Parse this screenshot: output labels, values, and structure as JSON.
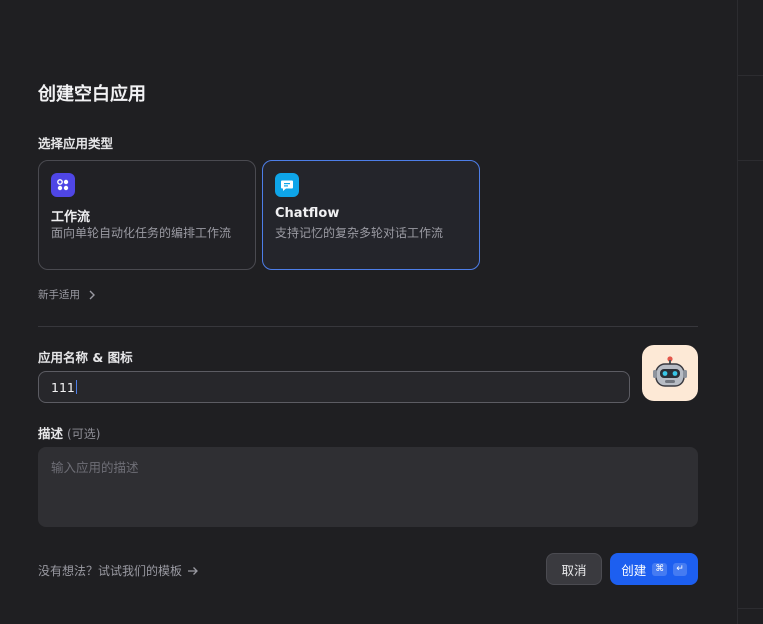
{
  "dialog": {
    "title": "创建空白应用",
    "type_label": "选择应用类型",
    "types": [
      {
        "name": "工作流",
        "description": "面向单轮自动化任务的编排工作流",
        "icon": "workflow-icon",
        "color": "#4f46e5",
        "selected": false
      },
      {
        "name": "Chatflow",
        "description": "支持记忆的复杂多轮对话工作流",
        "icon": "chatflow-icon",
        "color": "#0ea5e9",
        "selected": true
      }
    ],
    "beginner_label": "新手适用",
    "name_label": "应用名称 & 图标",
    "name_value": "111",
    "app_icon": "robot-icon",
    "description_label": "描述",
    "description_optional": "(可选)",
    "description_placeholder": "输入应用的描述",
    "hint_text": "没有想法？试试我们的模板",
    "cancel_label": "取消",
    "create_label": "创建",
    "create_shortcut": [
      "⌘",
      "↵"
    ],
    "accent_color": "#1d5ff0"
  }
}
